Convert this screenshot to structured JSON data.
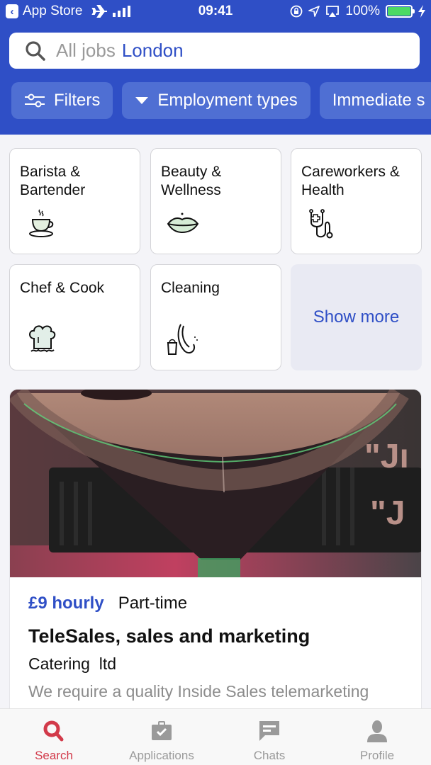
{
  "status_bar": {
    "back_app": "App Store",
    "time": "09:41",
    "battery": "100%",
    "battery_level": 1.0
  },
  "search": {
    "placeholder": "All jobs",
    "location": "London"
  },
  "filters": [
    {
      "label": "Filters",
      "icon": "sliders-icon"
    },
    {
      "label": "Employment types",
      "icon": "caret-down-icon"
    },
    {
      "label": "Immediate s",
      "icon": ""
    }
  ],
  "categories": [
    {
      "label": "Barista & Bartender",
      "icon": "coffee-cup-icon"
    },
    {
      "label": "Beauty & Wellness",
      "icon": "lips-icon"
    },
    {
      "label": "Careworkers & Health",
      "icon": "stethoscope-icon"
    },
    {
      "label": "Chef & Cook",
      "icon": "chef-hat-icon"
    },
    {
      "label": "Cleaning",
      "icon": "mop-bucket-icon"
    }
  ],
  "show_more": "Show more",
  "job": {
    "rate": "£9 hourly",
    "type": "Part-time",
    "title": "TeleSales, sales and marketing",
    "company": "Catering  ltd",
    "description": "We require a quality Inside Sales telemarketing",
    "image": "espresso-martini-photo"
  },
  "tabbar": [
    {
      "label": "Search",
      "icon": "search-icon",
      "active": true
    },
    {
      "label": "Applications",
      "icon": "briefcase-check-icon",
      "active": false
    },
    {
      "label": "Chats",
      "icon": "chat-bubble-icon",
      "active": false
    },
    {
      "label": "Profile",
      "icon": "person-icon",
      "active": false
    }
  ],
  "colors": {
    "brand": "#2f4fc6",
    "chip": "#4f6fd3",
    "active_tab": "#d23a4a",
    "inactive_tab": "#9a9a9a"
  }
}
